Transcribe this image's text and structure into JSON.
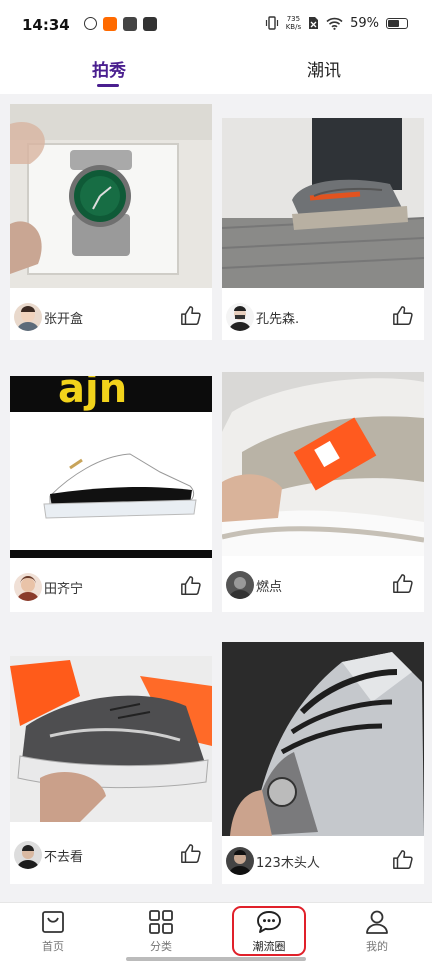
{
  "status_bar": {
    "time": "14:34",
    "net_speed_value": "735",
    "net_speed_unit": "KB/s",
    "battery": "59%"
  },
  "tabs": [
    {
      "label": "拍秀",
      "active": true
    },
    {
      "label": "潮讯",
      "active": false
    }
  ],
  "feed": {
    "posts": [
      {
        "user": "张开盒",
        "image": "watch-photo",
        "liked": false
      },
      {
        "user": "孔先森.",
        "image": "sneaker-on-foot-photo",
        "liked": false
      },
      {
        "user": "田齐宁",
        "image": "black-white-high-top-sneaker-photo",
        "image_text": "ajn",
        "liked": false
      },
      {
        "user": "燃点",
        "image": "white-grey-sneaker-with-tag-photo",
        "liked": false
      },
      {
        "user": "不去看",
        "image": "grey-running-shoe-photo",
        "liked": false
      },
      {
        "user": "123木头人",
        "image": "grey-high-top-sneaker-photo",
        "liked": false
      }
    ]
  },
  "bottom_nav": [
    {
      "label": "首页",
      "icon": "home-bag-icon",
      "active": false
    },
    {
      "label": "分类",
      "icon": "grid-icon",
      "active": false
    },
    {
      "label": "潮流圈",
      "icon": "chat-bubble-icon",
      "active": true
    },
    {
      "label": "我的",
      "icon": "user-icon",
      "active": false
    }
  ],
  "colors": {
    "accent": "#4a1f8f",
    "highlight": "#e0202a"
  }
}
